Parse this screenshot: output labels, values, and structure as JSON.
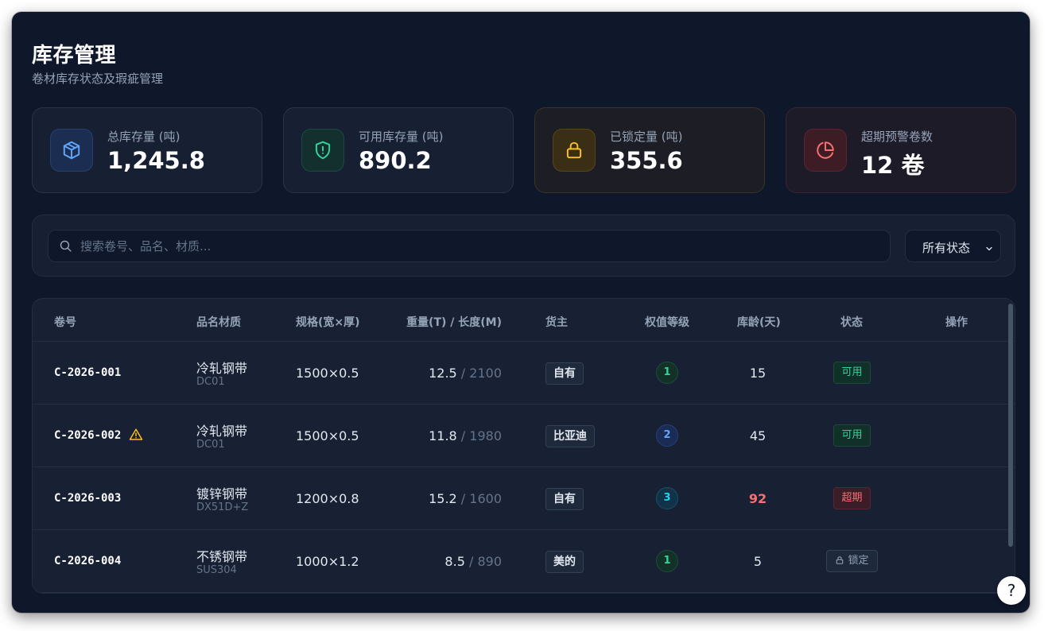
{
  "header": {
    "title": "库存管理",
    "subtitle": "卷材库存状态及瑕疵管理"
  },
  "stats": [
    {
      "label": "总库存量 (吨)",
      "value": "1,245.8",
      "icon": "box-icon",
      "color": "#60a5fa"
    },
    {
      "label": "可用库存量 (吨)",
      "value": "890.2",
      "icon": "shield-alert-icon",
      "color": "#34d399"
    },
    {
      "label": "已锁定量 (吨)",
      "value": "355.6",
      "icon": "lock-icon",
      "color": "#fbbf24"
    },
    {
      "label": "超期预警卷数",
      "value": "12 卷",
      "icon": "pie-chart-icon",
      "color": "#f87171"
    }
  ],
  "filters": {
    "search_placeholder": "搜索卷号、品名、材质...",
    "status_selected": "所有状态"
  },
  "table": {
    "headers": {
      "coil_no": "卷号",
      "product": "品名材质",
      "spec": "规格(宽×厚)",
      "weight_length": "重量(T) / 长度(M)",
      "owner": "货主",
      "grade": "权值等级",
      "age": "库龄(天)",
      "status": "状态",
      "actions": "操作"
    },
    "rows": [
      {
        "coil_no": "C-2026-001",
        "name": "冷轧钢带",
        "material": "DC01",
        "spec": "1500×0.5",
        "weight": "12.5",
        "sep": "/",
        "length": "2100",
        "owner": "自有",
        "grade": "1",
        "age": "15",
        "status": "可用"
      },
      {
        "coil_no": "C-2026-002",
        "name": "冷轧钢带",
        "material": "DC01",
        "spec": "1500×0.5",
        "weight": "11.8",
        "sep": "/",
        "length": "1980",
        "owner": "比亚迪",
        "grade": "2",
        "age": "45",
        "status": "可用"
      },
      {
        "coil_no": "C-2026-003",
        "name": "镀锌钢带",
        "material": "DX51D+Z",
        "spec": "1200×0.8",
        "weight": "15.2",
        "sep": "/",
        "length": "1600",
        "owner": "自有",
        "grade": "3",
        "age": "92",
        "status": "超期"
      },
      {
        "coil_no": "C-2026-004",
        "name": "不锈钢带",
        "material": "SUS304",
        "spec": "1000×1.2",
        "weight": "8.5",
        "sep": "/",
        "length": "890",
        "owner": "美的",
        "grade": "1",
        "age": "5",
        "status": "锁定"
      }
    ]
  },
  "help": {
    "label": "?"
  }
}
